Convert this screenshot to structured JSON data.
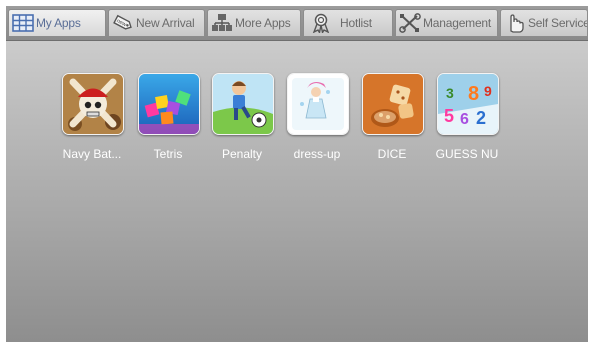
{
  "tabs": [
    {
      "label": "My Apps",
      "icon": "grid-icon",
      "active": true
    },
    {
      "label": "New Arrival",
      "icon": "new-tag-icon",
      "active": false
    },
    {
      "label": "More Apps",
      "icon": "network-icon",
      "active": false
    },
    {
      "label": "Hotlist",
      "icon": "award-icon",
      "active": false
    },
    {
      "label": "Management",
      "icon": "tools-icon",
      "active": false
    },
    {
      "label": "Self Service",
      "icon": "hand-icon",
      "active": false
    }
  ],
  "apps": [
    {
      "label": "Navy Bat..."
    },
    {
      "label": "Tetris"
    },
    {
      "label": "Penalty"
    },
    {
      "label": "dress-up"
    },
    {
      "label": "DICE"
    },
    {
      "label": "GUESS NU"
    }
  ],
  "colors": {
    "active_tab_text": "#5a6e97",
    "tab_text": "#6b6b6b",
    "app_label": "#ffffff"
  }
}
